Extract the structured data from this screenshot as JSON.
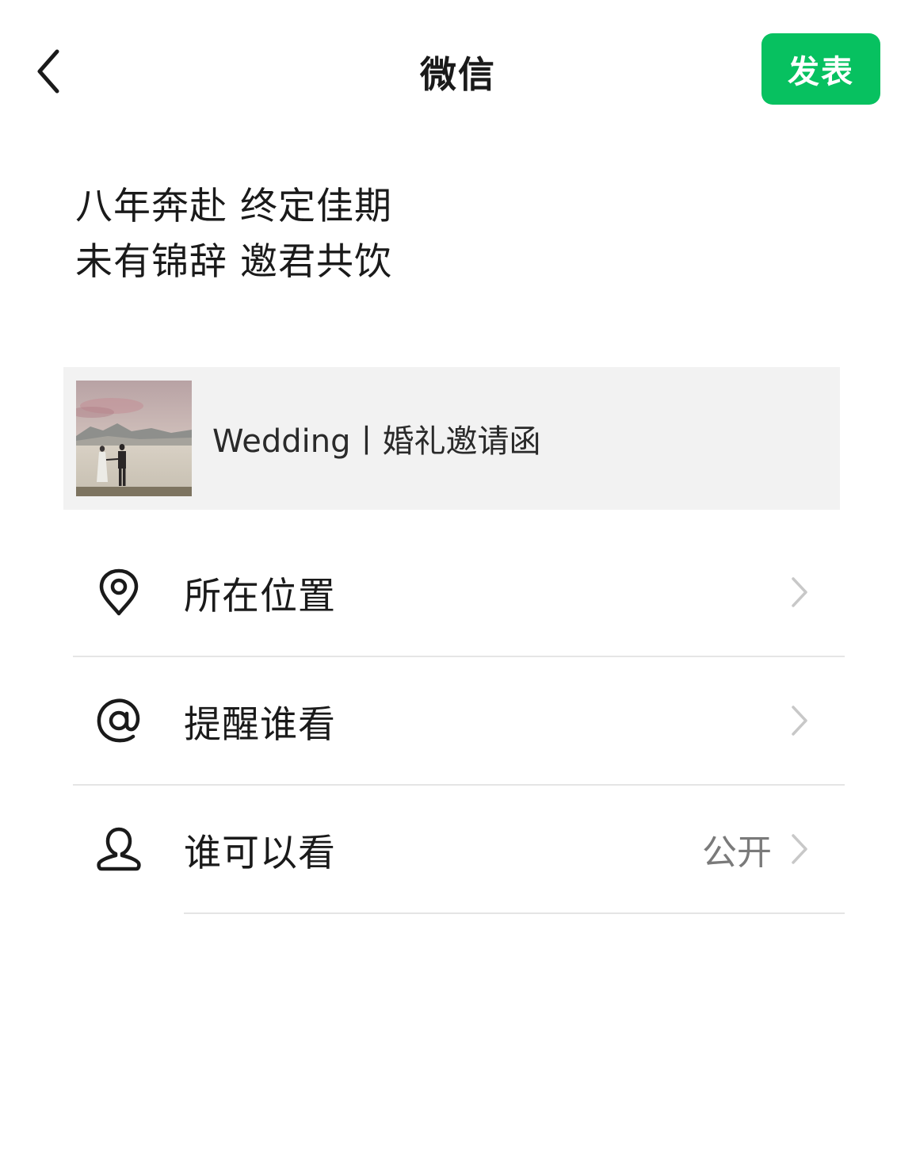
{
  "header": {
    "title": "微信",
    "publish_label": "发表"
  },
  "post": {
    "lines": [
      "八年奔赴 终定佳期",
      "未有锦辞 邀君共饮"
    ]
  },
  "link_card": {
    "label": "Wedding丨婚礼邀请函"
  },
  "options": [
    {
      "icon": "location-pin-icon",
      "label": "所在位置",
      "value": ""
    },
    {
      "icon": "at-sign-icon",
      "label": "提醒谁看",
      "value": ""
    },
    {
      "icon": "person-icon",
      "label": "谁可以看",
      "value": "公开"
    }
  ],
  "colors": {
    "accent": "#07c160",
    "card_bg": "#f2f2f2",
    "divider": "#e5e5e5",
    "chevron": "#c8c8c8"
  }
}
